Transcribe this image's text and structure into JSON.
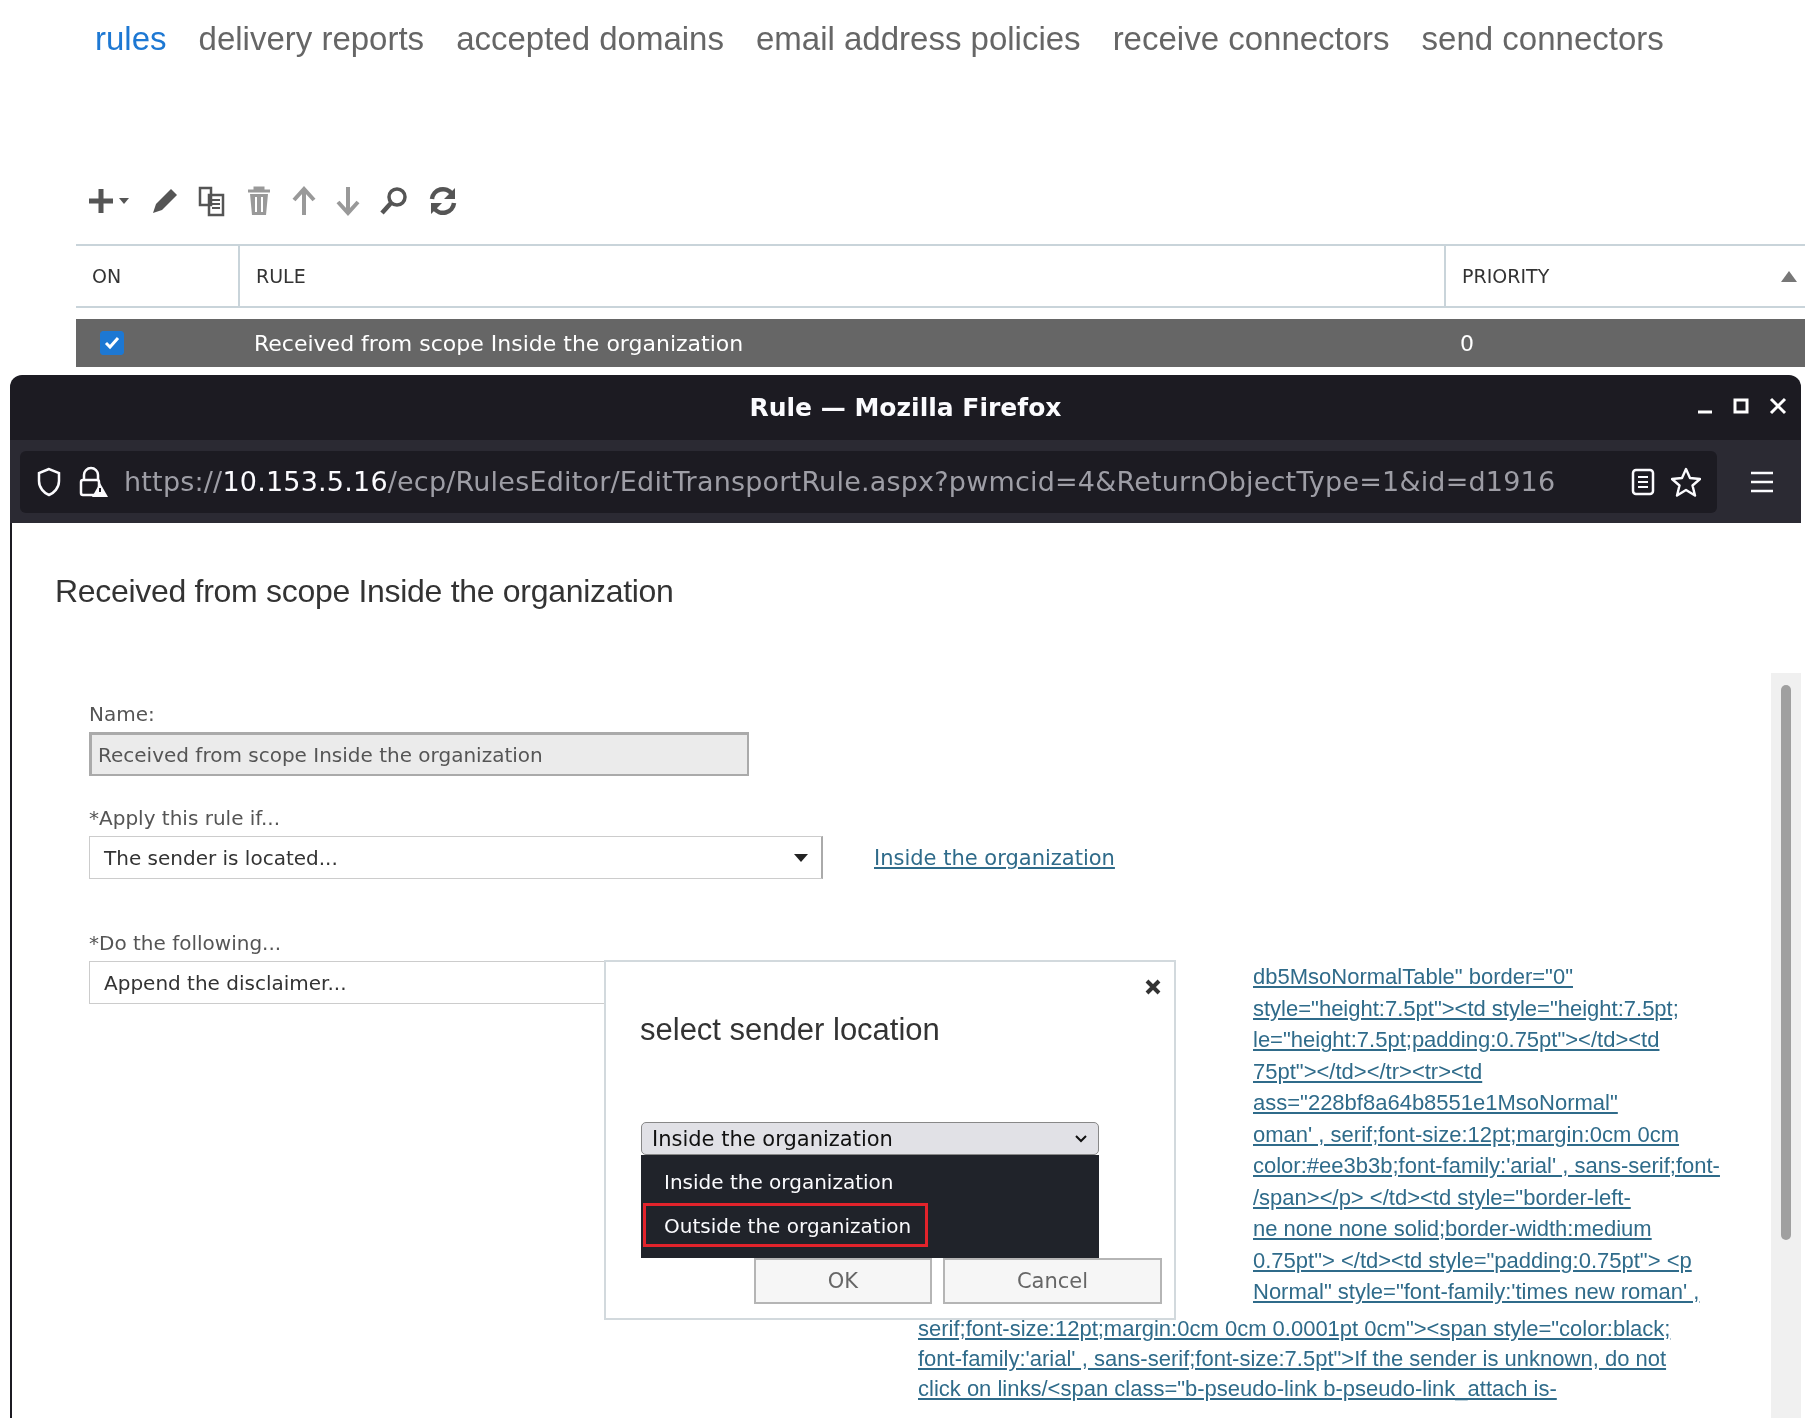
{
  "tabs": [
    {
      "label": "rules",
      "selected": true
    },
    {
      "label": "delivery reports",
      "selected": false
    },
    {
      "label": "accepted domains",
      "selected": false
    },
    {
      "label": "email address policies",
      "selected": false
    },
    {
      "label": "receive connectors",
      "selected": false
    },
    {
      "label": "send connectors",
      "selected": false
    }
  ],
  "rules_table": {
    "columns": [
      "ON",
      "RULE",
      "PRIORITY"
    ],
    "rows": [
      {
        "on": true,
        "selected": true,
        "rule": "Received from scope Inside the organization",
        "priority": "0"
      }
    ]
  },
  "browser_window": {
    "title": "Rule — Mozilla Firefox",
    "url": {
      "scheme": "https://",
      "host": "10.153.5.16",
      "path": "/ecp/RulesEditor/EditTransportRule.aspx?pwmcid=4&ReturnObjectType=1&id=d1916"
    }
  },
  "rule_form": {
    "heading": "Received from scope Inside the organization",
    "name_label": "Name:",
    "name_value": "Received from scope Inside the organization",
    "name_disabled": true,
    "condition_label": "*Apply this rule if...",
    "condition_value": "The sender is located...",
    "condition_link": "Inside the organization",
    "action_label": "*Do the following...",
    "action_value": "Append the disclaimer...",
    "disclaimer_lines_beside_dialog": [
      "db5MsoNormalTable\" border=\"0\"",
      "style=\"height:7.5pt\"><td style=\"height:7.5pt;",
      "le=\"height:7.5pt;padding:0.75pt\"></td><td",
      "75pt\"></td></tr><tr><td",
      "ass=\"228bf8a64b8551e1MsoNormal\"",
      "oman' , serif;font-size:12pt;margin:0cm 0cm",
      "color:#ee3b3b;font-family:'arial' , sans-serif;font-",
      "/span></p> </td><td style=\"border-left-",
      "ne none none solid;border-width:medium",
      "0.75pt\"> </td><td style=\"padding:0.75pt\"> <p",
      "Normal\" style=\"font-family:'times new roman' ,"
    ],
    "disclaimer_lines": [
      "serif;font-size:12pt;margin:0cm 0cm 0.0001pt 0cm\"><span style=\"color:black;",
      "font-family:'arial' , sans-serif;font-size:7.5pt\">If the sender is unknown, do not",
      "click on links/<span class=\"b-pseudo-link b-pseudo-link_attach is-"
    ]
  },
  "dialog": {
    "title": "select sender location",
    "select_value": "Inside the organization",
    "options": [
      {
        "label": "Inside the organization",
        "selected": false
      },
      {
        "label": "Outside the organization",
        "selected": true
      }
    ],
    "buttons": [
      "OK",
      "Cancel"
    ]
  }
}
